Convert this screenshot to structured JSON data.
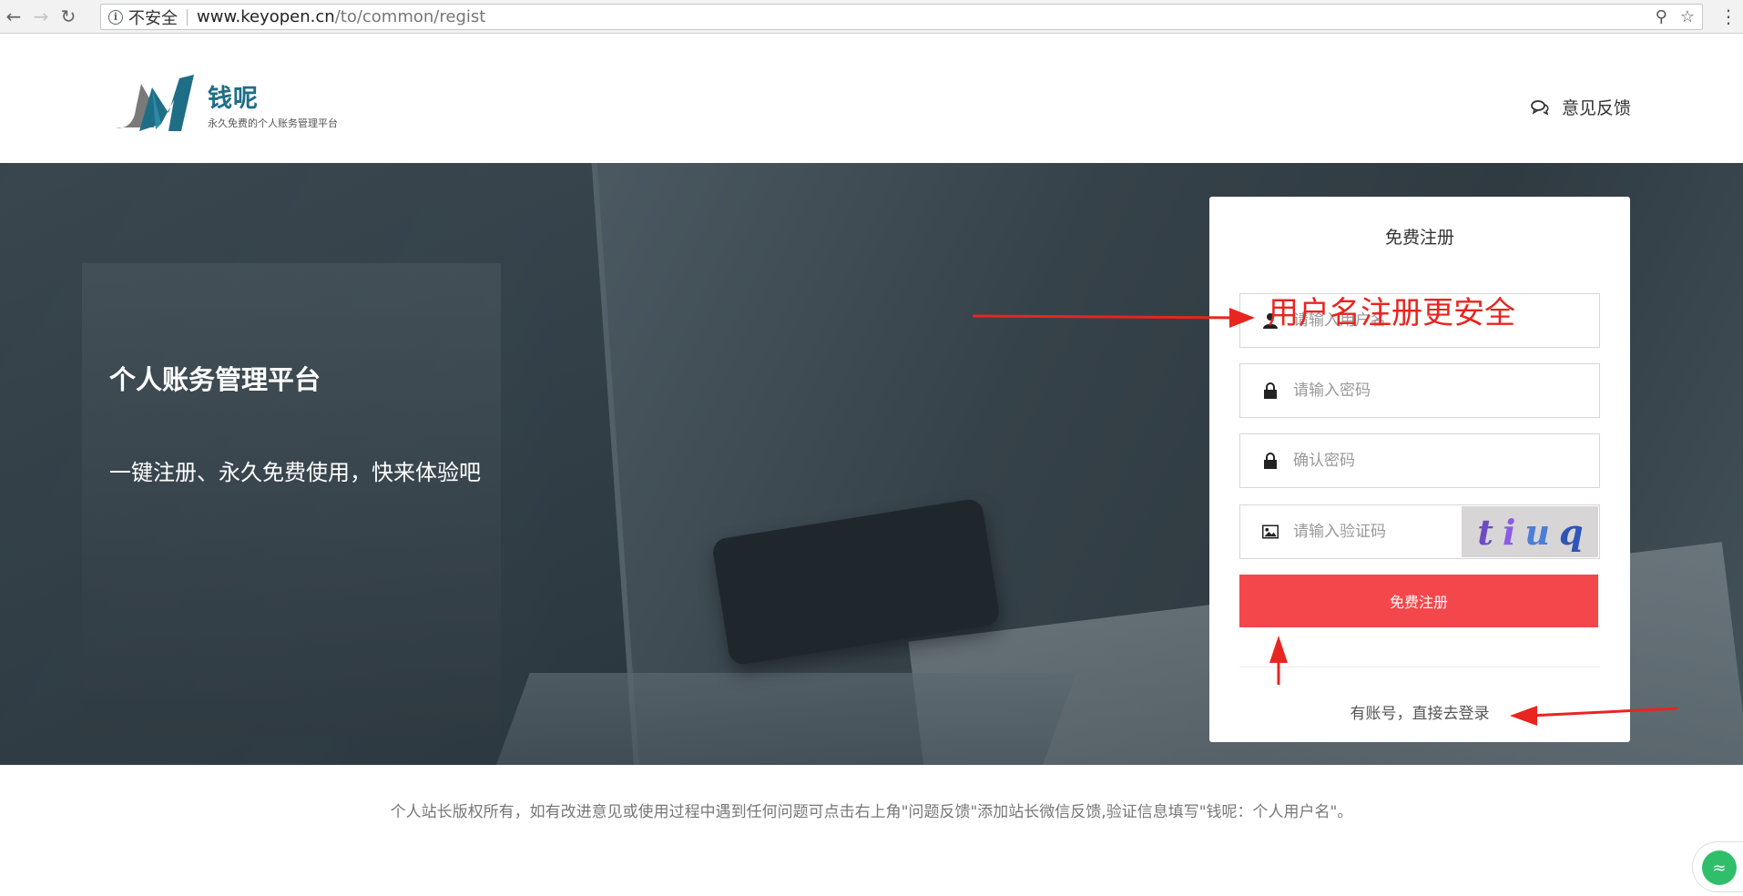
{
  "browser": {
    "security_label": "不安全",
    "url_host": "www.keyopen.cn",
    "url_path": "/to/common/regist"
  },
  "header": {
    "logo_name": "钱呢",
    "logo_tagline": "永久免费的个人账务管理平台",
    "feedback_label": "意见反馈"
  },
  "hero": {
    "title": "个人账务管理平台",
    "subtitle": "一键注册、永久免费使用，快来体验吧"
  },
  "register": {
    "title": "免费注册",
    "username_placeholder": "请输入用户名",
    "password_placeholder": "请输入密码",
    "confirm_placeholder": "确认密码",
    "captcha_placeholder": "请输入验证码",
    "captcha_text": [
      "t",
      "i",
      "u",
      "q"
    ],
    "submit_label": "免费注册",
    "login_link": "有账号，直接去登录"
  },
  "annotation": {
    "note": "用户名注册更安全",
    "color": "#e8251f"
  },
  "footer": {
    "text": "个人站长版权所有，如有改进意见或使用过程中遇到任何问题可点击右上角\"问题反馈\"添加站长微信反馈,验证信息填写\"钱呢：个人用户名\"。"
  },
  "colors": {
    "accent": "#f4474b",
    "brand": "#1e6e86"
  }
}
